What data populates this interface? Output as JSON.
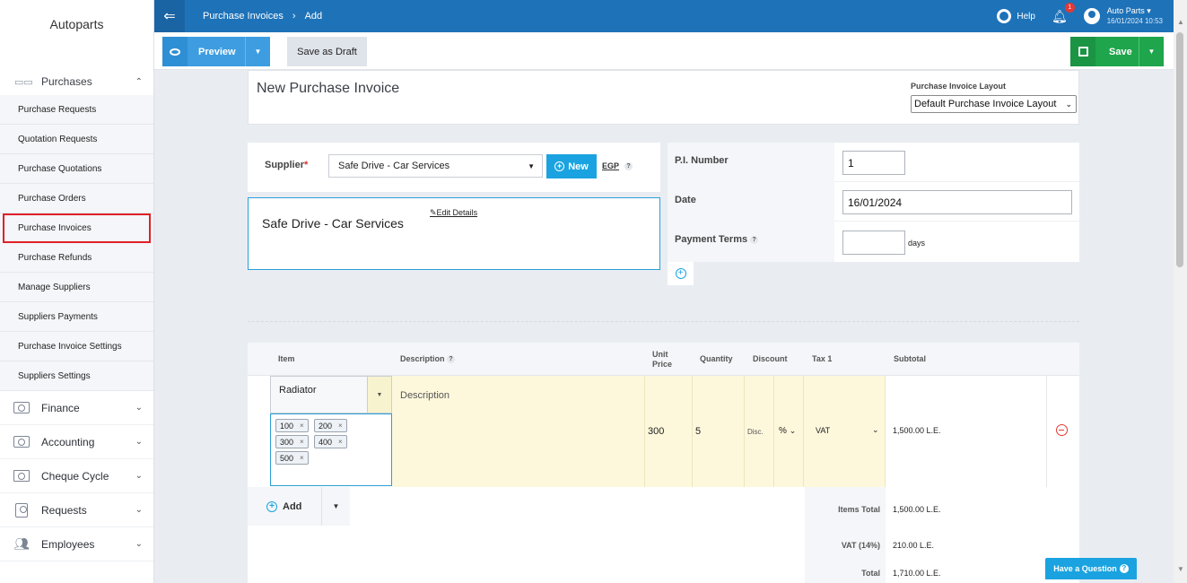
{
  "sidebar": {
    "brand": "Autoparts",
    "section": "Purchases",
    "sub_items": [
      "Purchase Requests",
      "Quotation Requests",
      "Purchase Quotations",
      "Purchase Orders",
      "Purchase Invoices",
      "Purchase Refunds",
      "Manage Suppliers",
      "Suppliers Payments",
      "Purchase Invoice Settings",
      "Suppliers Settings"
    ],
    "menu": [
      "Finance",
      "Accounting",
      "Cheque Cycle",
      "Requests",
      "Employees"
    ]
  },
  "topbar": {
    "crumb1": "Purchase Invoices",
    "crumb2": "Add",
    "help": "Help",
    "notif_count": "1",
    "user_name": "Auto Parts",
    "user_date": "16/01/2024 10:53"
  },
  "toolbar": {
    "preview": "Preview",
    "draft": "Save as Draft",
    "save": "Save"
  },
  "header": {
    "title": "New Purchase Invoice",
    "layout_label": "Purchase Invoice Layout",
    "layout_value": "Default Purchase Invoice Layout"
  },
  "supplier": {
    "label": "Supplier",
    "value": "Safe Drive - Car Services",
    "new_btn": "New",
    "currency": "EGP",
    "detail_name": "Safe Drive - Car Services",
    "edit": "Edit Details"
  },
  "info": {
    "pi_label": "P.I. Number",
    "pi_value": "1",
    "date_label": "Date",
    "date_value": "16/01/2024",
    "terms_label": "Payment Terms",
    "terms_value": "",
    "days": "days"
  },
  "table": {
    "headers": {
      "item": "Item",
      "description": "Description",
      "unit_price_1": "Unit",
      "unit_price_2": "Price",
      "quantity": "Quantity",
      "discount": "Discount",
      "tax": "Tax 1",
      "subtotal": "Subtotal"
    },
    "row": {
      "item": "Radiator",
      "tags": [
        "100",
        "200",
        "300",
        "400",
        "500"
      ],
      "description": "Description",
      "unit_price": "300",
      "quantity": "5",
      "discount": "Disc.",
      "discount_type": "%",
      "tax": "VAT",
      "subtotal": "1,500.00 L.E."
    },
    "add": "Add"
  },
  "totals": {
    "items_total_label": "Items Total",
    "items_total": "1,500.00 L.E.",
    "vat_label": "VAT (14%)",
    "vat": "210.00 L.E.",
    "total_label": "Total",
    "total": "1,710.00 L.E."
  },
  "help_widget": "Have a Question"
}
